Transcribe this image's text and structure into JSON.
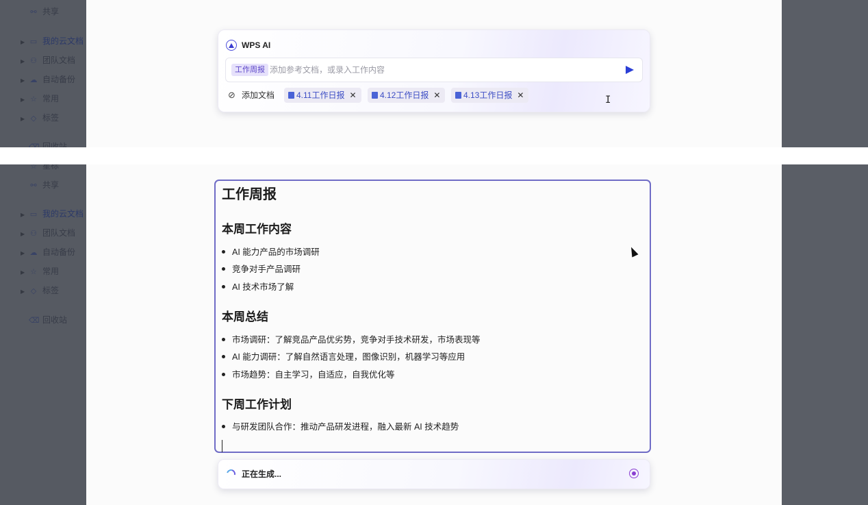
{
  "sidebar_top": [
    {
      "label": "共享",
      "icon": "share-icon"
    },
    {
      "label": "我的云文档",
      "icon": "folder-icon"
    },
    {
      "label": "团队文档",
      "icon": "team-icon"
    },
    {
      "label": "自动备份",
      "icon": "backup-icon"
    },
    {
      "label": "常用",
      "icon": "star-icon"
    },
    {
      "label": "标签",
      "icon": "tag-icon"
    },
    {
      "label": "回收站",
      "icon": "trash-icon"
    }
  ],
  "sidebar_bottom": [
    {
      "label": "星标",
      "icon": "star-icon"
    },
    {
      "label": "共享",
      "icon": "share-icon"
    },
    {
      "label": "我的云文档",
      "icon": "folder-icon"
    },
    {
      "label": "团队文档",
      "icon": "team-icon"
    },
    {
      "label": "自动备份",
      "icon": "backup-icon"
    },
    {
      "label": "常用",
      "icon": "star-icon"
    },
    {
      "label": "标签",
      "icon": "tag-icon"
    },
    {
      "label": "回收站",
      "icon": "trash-icon"
    }
  ],
  "ai_box": {
    "title": "WPS AI",
    "tag": "工作周报",
    "placeholder": "添加参考文档，或录入工作内容",
    "add_doc_label": "添加文档",
    "attachments": [
      "4.11工作日报",
      "4.12工作日报",
      "4.13工作日报"
    ],
    "remove_symbol": "✕"
  },
  "document": {
    "title": "工作周报",
    "sections": [
      {
        "heading": "本周工作内容",
        "items": [
          "AI 能力产品的市场调研",
          "竞争对手产品调研",
          "AI 技术市场了解"
        ]
      },
      {
        "heading": "本周总结",
        "items": [
          "市场调研：了解竞品产品优劣势，竞争对手技术研发，市场表现等",
          "AI 能力调研：了解自然语言处理，图像识别，机器学习等应用",
          "市场趋势：自主学习，自适应，自我优化等"
        ]
      },
      {
        "heading": "下周工作计划",
        "items": [
          "与研发团队合作：推动产品研发进程，融入最新 AI 技术趋势"
        ]
      }
    ]
  },
  "status": {
    "generating_label": "正在生成..."
  },
  "colors": {
    "accent": "#6f6cc6",
    "sidebar_bg": "#565a62",
    "tag_bg": "#e6e1fb",
    "chip_text": "#3b4cc4",
    "stop": "#8a3fd1"
  }
}
